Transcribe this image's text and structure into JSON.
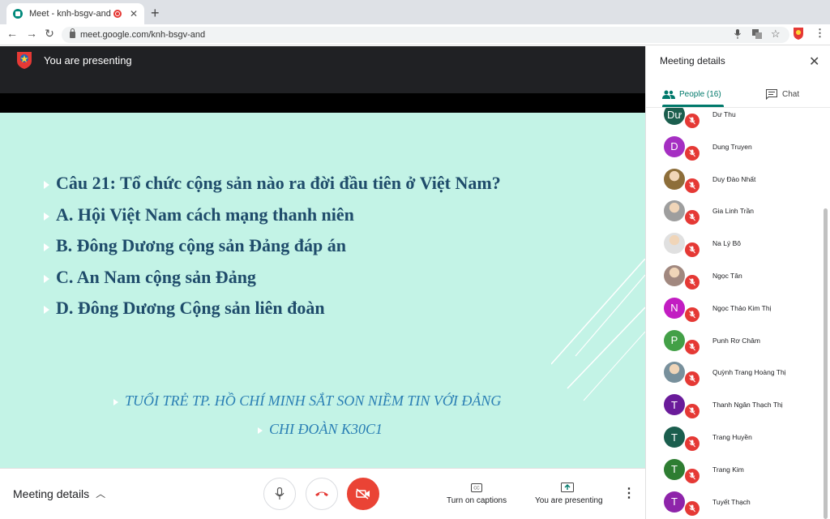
{
  "browser": {
    "tab_title": "Meet - knh-bsgv-and",
    "url": "meet.google.com/knh-bsgv-and"
  },
  "presenting": {
    "banner_text": "You are presenting"
  },
  "slide": {
    "bullets": [
      "Câu 21: Tổ chức cộng sản nào ra đời đầu tiên ở Việt Nam?",
      "A. Hội Việt Nam cách mạng thanh niên",
      "B. Đông Dương cộng sản Đảng đáp án",
      "C. An Nam cộng sản Đảng",
      "D. Đông Dương Cộng sản liên đoàn"
    ],
    "motto_1": "TUỔI TRẺ TP. HỒ CHÍ MINH SẮT SON NIỀM TIN VỚI ĐẢNG",
    "motto_2": "CHI ĐOÀN K30C1"
  },
  "controls": {
    "meeting_details": "Meeting details",
    "captions_label": "Turn on captions",
    "presenting_label": "You are presenting"
  },
  "panel": {
    "title": "Meeting details",
    "people_tab": "People (16)",
    "chat_tab": "Chat",
    "people": [
      {
        "name": "Dư Thu",
        "initial": "Dư",
        "color": "#1b5e4e",
        "photo": false
      },
      {
        "name": "Dung Truyen",
        "initial": "D",
        "color": "#a52fc2",
        "photo": false
      },
      {
        "name": "Duy Đào Nhất",
        "initial": "",
        "color": "#8d6e3a",
        "photo": true
      },
      {
        "name": "Gia Linh Trần",
        "initial": "",
        "color": "#9e9e9e",
        "photo": true
      },
      {
        "name": "Na Lý Bô",
        "initial": "",
        "color": "#e0e0e0",
        "photo": true
      },
      {
        "name": "Ngọc Tân",
        "initial": "",
        "color": "#a1887f",
        "photo": true
      },
      {
        "name": "Ngọc Thảo Kim Thị",
        "initial": "N",
        "color": "#c21dc2",
        "photo": false
      },
      {
        "name": "Punh Rơ Châm",
        "initial": "P",
        "color": "#43a047",
        "photo": false
      },
      {
        "name": "Quỳnh Trang Hoàng Thị",
        "initial": "",
        "color": "#78909c",
        "photo": true
      },
      {
        "name": "Thanh Ngân Thạch Thị",
        "initial": "T",
        "color": "#6a1b9a",
        "photo": false
      },
      {
        "name": "Trang Huyền",
        "initial": "T",
        "color": "#1b5e4e",
        "photo": false
      },
      {
        "name": "Trang Kim",
        "initial": "T",
        "color": "#2e7d32",
        "photo": false
      },
      {
        "name": "Tuyết Thạch",
        "initial": "T",
        "color": "#8e24aa",
        "photo": false
      }
    ]
  }
}
